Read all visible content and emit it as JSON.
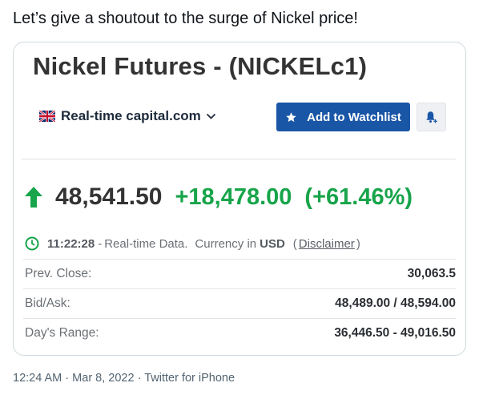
{
  "tweet": {
    "text": "Let’s give a shoutout to the surge of Nickel price!",
    "time": "12:24 AM",
    "date": "Mar 8, 2022",
    "source": "Twitter for iPhone",
    "dot": "·"
  },
  "quote": {
    "title": "Nickel Futures - (NICKELc1)",
    "data_source": "Real-time capital.com",
    "watchlist_label": "Add to Watchlist",
    "last_price": "48,541.50",
    "change_abs": "+18,478.00",
    "change_pct": "(+61.46%)",
    "time": "11:22:28",
    "sep": "-",
    "realtime_label": "Real-time Data.",
    "currency_label": "Currency in",
    "currency": "USD",
    "disclaimer_open": "(",
    "disclaimer": "Disclaimer",
    "disclaimer_close": ")",
    "up_color": "#17a44a",
    "accent_color": "#1a56a6",
    "icons": [
      "uk-flag-icon",
      "chevron-down-icon",
      "star-icon",
      "bell-add-icon",
      "up-arrow-icon",
      "clock-icon"
    ],
    "stats": [
      {
        "label": "Prev. Close:",
        "value": "30,063.5"
      },
      {
        "label": "Bid/Ask:",
        "value": "48,489.00 / 48,594.00"
      },
      {
        "label": "Day's Range:",
        "value": "36,446.50 - 49,016.50"
      }
    ]
  }
}
